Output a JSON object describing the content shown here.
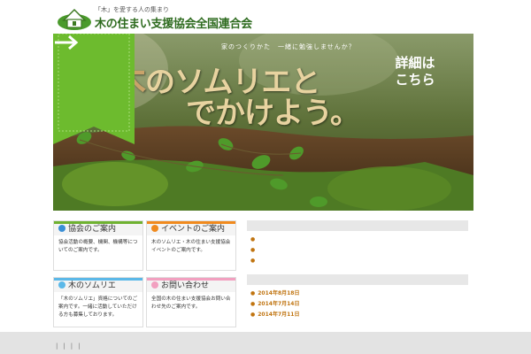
{
  "header": {
    "tagline": "「木」を愛する人の集まり",
    "org_name": "木の住まい支援協会全国連合会"
  },
  "hero": {
    "kicker": "家のつくりかた　一緒に勉強しませんか？",
    "title_big": "木",
    "title_rest": "のソムリエと",
    "title_line2": "でかけよう。",
    "detail_line1": "詳細は",
    "detail_line2": "こちら",
    "slides": 4,
    "active_slide": 1
  },
  "boxes": [
    {
      "title": "協会のご案内",
      "color": "#3a8fd6",
      "body": "協会活動の概要、機関、機構等についてのご案内です。"
    },
    {
      "title": "イベントのご案内",
      "color": "#f08a1e",
      "body": "木のソムリエ・木の住まい支援協会イベントのご案内です。"
    },
    {
      "title": "木のソムリエ",
      "color": "#5bb8e8",
      "body": "「木のソムリエ」資格についてのご案内です。一緒に活動していただける方も募集しております。"
    },
    {
      "title": "お問い合わせ",
      "color": "#f2a0c0",
      "body": "全国の木の住まい支援協会お問い合わせ先のご案内です。"
    }
  ],
  "right": {
    "section1_title": "",
    "section1_links": [
      "",
      "",
      ""
    ],
    "section2_title": "",
    "news": [
      {
        "date": "2014年8月18日",
        "text": ""
      },
      {
        "date": "2014年7月14日",
        "text": ""
      },
      {
        "date": "2014年7月11日",
        "text": ""
      }
    ],
    "more_label": ""
  },
  "footer": {
    "links": [
      "",
      "",
      "",
      "",
      ""
    ]
  }
}
